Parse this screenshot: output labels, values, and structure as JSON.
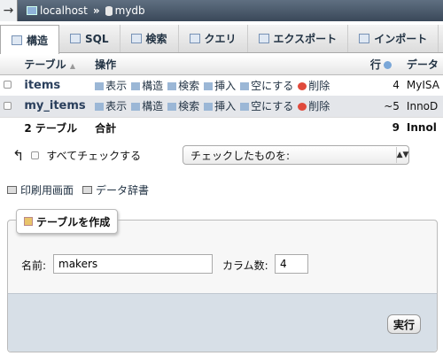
{
  "breadcrumb": {
    "server": "localhost",
    "separator": "»",
    "database": "mydb",
    "back_glyph": "→"
  },
  "tabs": [
    {
      "label": "構造",
      "icon": "structure-icon",
      "active": true
    },
    {
      "label": "SQL",
      "icon": "sql-icon",
      "active": false
    },
    {
      "label": "検索",
      "icon": "search-icon",
      "active": false
    },
    {
      "label": "クエリ",
      "icon": "query-icon",
      "active": false
    },
    {
      "label": "エクスポート",
      "icon": "export-icon",
      "active": false
    },
    {
      "label": "インポート",
      "icon": "import-icon",
      "active": false
    }
  ],
  "table": {
    "headers": {
      "table": "テーブル",
      "sort_glyph": "▲",
      "actions": "操作",
      "rows": "行",
      "type": "データ"
    },
    "actions": {
      "browse": "表示",
      "structure": "構造",
      "search": "検索",
      "insert": "挿入",
      "empty": "空にする",
      "drop": "削除"
    },
    "rows": [
      {
        "name": "items",
        "count": "4",
        "type": "MyISA"
      },
      {
        "name": "my_items",
        "count": "~5",
        "type": "InnoD"
      }
    ],
    "footer": {
      "summary": "2 テーブル",
      "total_label": "合計",
      "total": "9",
      "type": "Innol"
    }
  },
  "bulk": {
    "arrow": "↰",
    "check_all": "すべてチェックする",
    "with_selected": "チェックしたものを:",
    "caret": "▲▼"
  },
  "links": {
    "print": "印刷用画面",
    "dictionary": "データ辞書"
  },
  "create_table": {
    "legend": "テーブルを作成",
    "name_label": "名前:",
    "name_value": "makers",
    "columns_label": "カラム数:",
    "columns_value": "4",
    "go": "実行"
  }
}
